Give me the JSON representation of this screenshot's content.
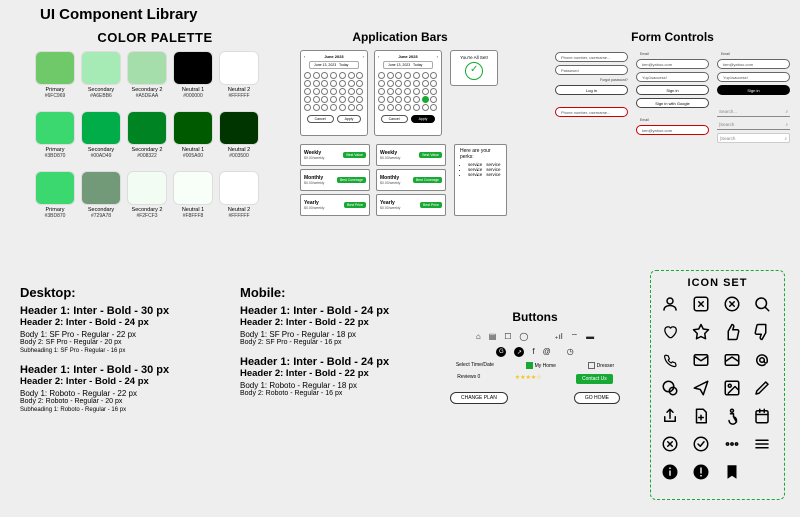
{
  "title": "UI Component Library",
  "palette": {
    "heading": "COLOR PALETTE",
    "rows": [
      [
        {
          "name": "Primary",
          "hex": "#6FC969"
        },
        {
          "name": "Secondary",
          "hex": "#A6EBB6"
        },
        {
          "name": "Secondary 2",
          "hex": "#A5DEAA"
        },
        {
          "name": "Neutral 1",
          "hex": "#000000"
        },
        {
          "name": "Neutral 2",
          "hex": "#FFFFFF"
        }
      ],
      [
        {
          "name": "Primary",
          "hex": "#3BD870"
        },
        {
          "name": "Secondary",
          "hex": "#00AD49"
        },
        {
          "name": "Secondary 2",
          "hex": "#008322"
        },
        {
          "name": "Neutral 1",
          "hex": "#005A00"
        },
        {
          "name": "Neutral 2",
          "hex": "#003500"
        }
      ],
      [
        {
          "name": "Primary",
          "hex": "#3BD870"
        },
        {
          "name": "Secondary",
          "hex": "#729A78"
        },
        {
          "name": "Secondary 2",
          "hex": "#F2FCF3"
        },
        {
          "name": "Neutral 1",
          "hex": "#F8FFF8"
        },
        {
          "name": "Neutral 2",
          "hex": "#FFFFFF"
        }
      ]
    ]
  },
  "appbars": {
    "heading": "Application Bars",
    "cal_title": "June 2023",
    "date_text": "June 13, 2023",
    "today": "Today",
    "cancel": "Cancel",
    "apply": "Apply",
    "allset": "You're All Set!",
    "price_rows": [
      {
        "name": "Weekly",
        "price": "$0.00/weekly",
        "badge": "Best Value"
      },
      {
        "name": "Monthly",
        "price": "$0.00/weekly",
        "badge": "Best Coverage"
      },
      {
        "name": "Yearly",
        "price": "$0.00/weekly",
        "badge": "Best Price"
      }
    ],
    "perks_title": "Here are your perks:",
    "perk": "service"
  },
  "forms": {
    "heading": "Form Controls",
    "email_lbl": "Email",
    "email_val": "ken@yahoo.com",
    "ph_placeholder": "Phone number, username...",
    "pw_placeholder": "Password",
    "forgot": "Forgot password?",
    "login": "Log in",
    "pw2": "Yup1saccess!",
    "signin": "Sign in",
    "signin_google": "Sign in with Google",
    "search": "Search...",
    "search_box": "|Search"
  },
  "typography": {
    "desktop_heading": "Desktop:",
    "mobile_heading": "Mobile:",
    "d_h1": "Header 1: Inter - Bold - 30 px",
    "d_h2": "Header 2: Inter - Bold - 24 px",
    "d_b1_sf": "Body 1: SF Pro - Regular - 22 px",
    "d_b2_sf": "Body 2: SF Pro - Regular - 20 px",
    "d_sub_sf": "Subheading 1: SF Pro - Regular - 16 px",
    "d_b1_r": "Body 1: Roboto - Regular - 22 px",
    "d_b2_r": "Body 2: Roboto - Regular - 20 px",
    "d_sub_r": "Subheading 1: Roboto - Regular - 16 px",
    "m_h1": "Header 1: Inter - Bold - 24 px",
    "m_h2": "Header 2: Inter - Bold - 22 px",
    "m_b1_sf": "Body 1: SF Pro - Regular - 18 px",
    "m_b2_sf": "Body 2: SF Pro - Regular - 16 px",
    "m_b1_r": "Body 1: Roboto - Regular - 18 px",
    "m_b2_r": "Body 2: Roboto - Regular - 16 px"
  },
  "buttons": {
    "heading": "Buttons",
    "select_time": "Select Time/Date",
    "my_home": "My Home",
    "dresser": "Dresser",
    "reviews": "Reviews  0",
    "contact": "Contact Us",
    "change": "CHANGE PLAN",
    "gohome": "GO HOME"
  },
  "iconset": {
    "heading": "ICON SET"
  }
}
